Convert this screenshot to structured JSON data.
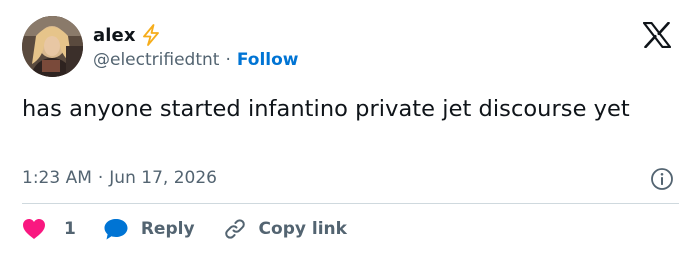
{
  "author": {
    "name": "alex",
    "badge_icon": "lightning-bolt-icon",
    "handle": "@electrifiedtnt",
    "separator": "·",
    "follow_label": "Follow"
  },
  "brand": {
    "logo_icon": "x-logo-icon"
  },
  "tweet": {
    "text": "has anyone started infantino private jet discourse yet",
    "time": "1:23 AM",
    "separator": "·",
    "date": "Jun 17, 2026"
  },
  "actions": {
    "like_count": "1",
    "reply_label": "Reply",
    "copy_label": "Copy link"
  },
  "colors": {
    "accent": "#0074d4",
    "heart": "#f91880",
    "bolt": "#f6ad1b",
    "text": "#0f1419",
    "muted": "#536471",
    "divider": "#cfd9de"
  }
}
